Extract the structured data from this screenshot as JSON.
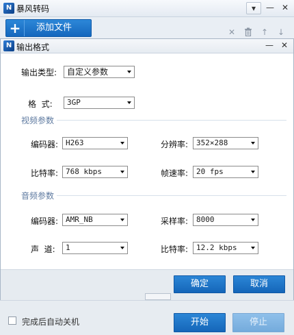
{
  "main": {
    "title": "暴风转码",
    "app_icon": "N",
    "minimize": "—",
    "menu": "▾",
    "close": "✕",
    "add_button": "添加文件",
    "add_plus": "+",
    "tool_icons": {
      "delete": "✕",
      "trash": "🗑",
      "up": "↑",
      "down": "↓"
    }
  },
  "dialog": {
    "title": "输出格式",
    "app_icon": "N",
    "minimize": "—",
    "close": "✕",
    "output_type_label": "输出类型:",
    "output_type_value": "自定义参数",
    "format_label": "格  式:",
    "format_value": "3GP",
    "video_section": "视频参数",
    "video_encoder_label": "编码器:",
    "video_encoder_value": "H263",
    "resolution_label": "分辨率:",
    "resolution_value": "352×288",
    "video_bitrate_label": "比特率:",
    "video_bitrate_value": "768 kbps",
    "framerate_label": "帧速率:",
    "framerate_value": "20 fps",
    "audio_section": "音频参数",
    "audio_encoder_label": "编码器:",
    "audio_encoder_value": "AMR_NB",
    "samplerate_label": "采样率:",
    "samplerate_value": "8000",
    "channel_label": "声  道:",
    "channel_value": "1",
    "audio_bitrate_label": "比特率:",
    "audio_bitrate_value": "12.2 kbps",
    "ok_button": "确定",
    "cancel_button": "取消"
  },
  "bottom": {
    "shutdown_label": "完成后自动关机",
    "start_button": "开始",
    "stop_button": "停止"
  }
}
